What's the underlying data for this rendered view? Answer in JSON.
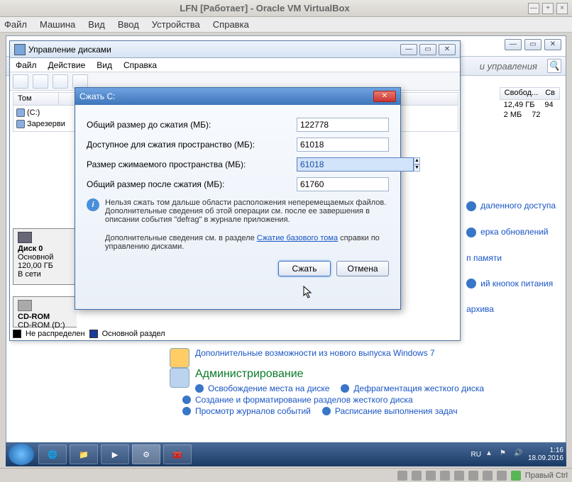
{
  "host": {
    "title": "LFN [Работает] - Oracle VM VirtualBox",
    "menu": [
      "Файл",
      "Машина",
      "Вид",
      "Ввод",
      "Устройства",
      "Справка"
    ],
    "status_right": "Правый Ctrl"
  },
  "cp": {
    "search_hint": "и управления",
    "search_icon": "🔍"
  },
  "dm": {
    "title": "Управление дисками",
    "menu": [
      "Файл",
      "Действие",
      "Вид",
      "Справка"
    ],
    "vol_headers": {
      "tom": "Том",
      "svobod": "Свобод...",
      "sv": "Св"
    },
    "vol_rows": [
      {
        "name": "(C:)",
        "free": "12,49 ГБ",
        "pct": "94"
      },
      {
        "name": "Зарезерви",
        "free": "2 МБ",
        "pct": "72"
      }
    ],
    "disk0": {
      "label": "Диск 0",
      "type": "Основной",
      "size": "120,00 ГБ",
      "state": "В сети"
    },
    "cdrom": {
      "label": "CD-ROM",
      "dev": "CD-ROM (D:)"
    },
    "legend": {
      "a": "Не распределен",
      "b": "Основной раздел"
    }
  },
  "dlg": {
    "title": "Сжать C:",
    "row1_label": "Общий размер до сжатия (МБ):",
    "row1_val": "122778",
    "row2_label": "Доступное для сжатия пространство (МБ):",
    "row2_val": "61018",
    "row3_label": "Размер сжимаемого пространства (МБ):",
    "row3_val": "61018",
    "row4_label": "Общий размер после сжатия (МБ):",
    "row4_val": "61760",
    "info1": "Нельзя сжать том дальше области расположения неперемещаемых файлов. Дополнительные сведения об этой операции см. после ее завершения в описании события \"defrag\" в журнале приложения.",
    "info2_pre": "Дополнительные сведения см. в разделе ",
    "info2_link": "Сжатие базового тома",
    "info2_post": " справки по управлению дисками.",
    "btn_ok": "Сжать",
    "btn_cancel": "Отмена"
  },
  "side": {
    "a": "даленного доступа",
    "b": "ерка обновлений",
    "c": "п памяти",
    "d": "ий кнопок питания",
    "e": "архива"
  },
  "links": {
    "w7": "Дополнительные возможности из нового выпуска Windows 7",
    "admin": "Администрирование",
    "l1": "Освобождение места на диске",
    "l2": "Дефрагментация жесткого диска",
    "l3": "Создание и форматирование разделов жесткого диска",
    "l4": "Просмотр журналов событий",
    "l5": "Расписание выполнения задач"
  },
  "taskbar": {
    "lang": "RU",
    "time": "1:16",
    "date": "18.09.2016"
  }
}
